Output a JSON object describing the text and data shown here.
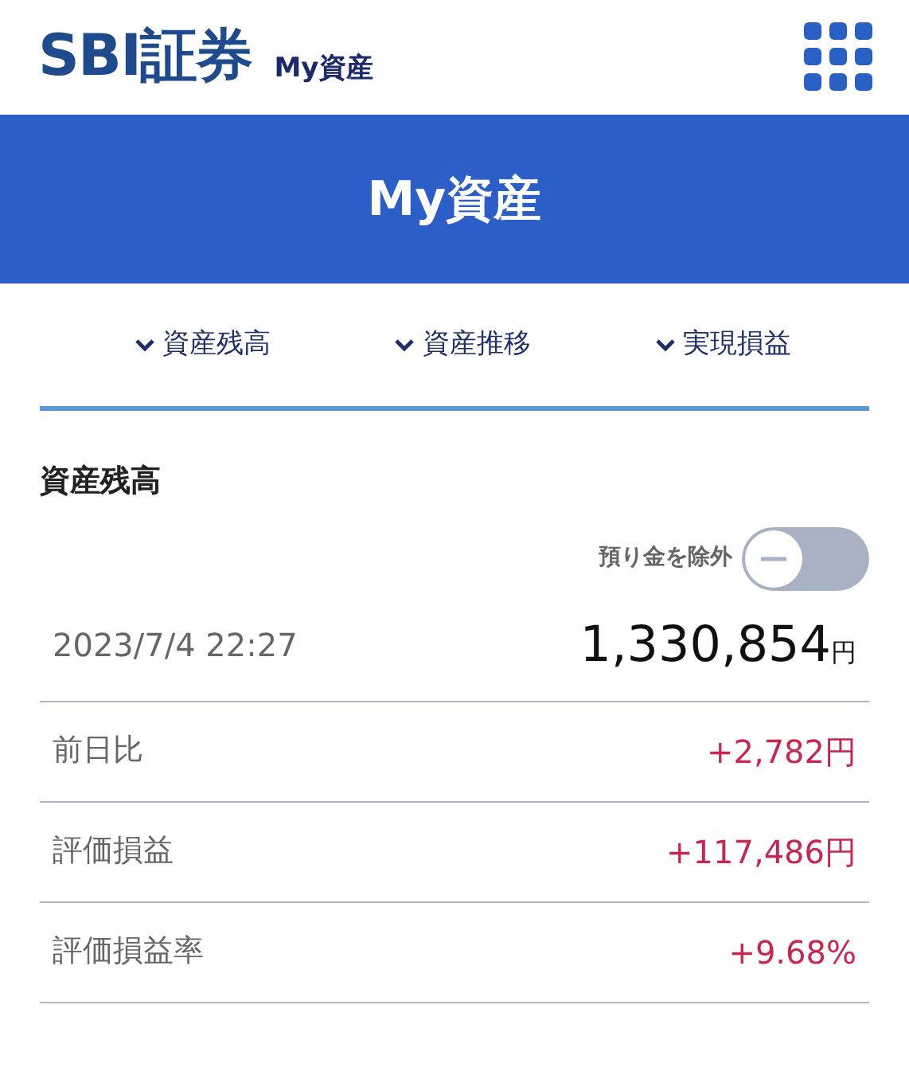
{
  "header": {
    "logo": "SBI証券",
    "subtitle": "My資産"
  },
  "banner": {
    "title": "My資産"
  },
  "nav": [
    {
      "label": "資産残高"
    },
    {
      "label": "資産推移"
    },
    {
      "label": "実現損益"
    }
  ],
  "section": {
    "title": "資産残高",
    "toggle": {
      "label": "預り金を除外",
      "on": false
    },
    "total": {
      "date": "2023/7/4 22:27",
      "amount": "1,330,854",
      "unit": "円"
    },
    "rows": [
      {
        "label": "前日比",
        "value": "+2,782円"
      },
      {
        "label": "評価損益",
        "value": "+117,486円"
      },
      {
        "label": "評価損益率",
        "value": "+9.68%"
      }
    ]
  }
}
